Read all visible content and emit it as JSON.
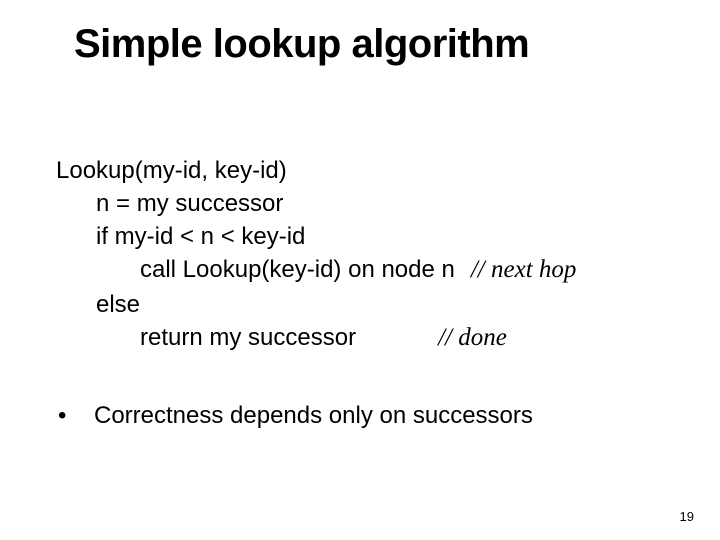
{
  "title": "Simple lookup algorithm",
  "code": {
    "l1": "Lookup(my-id, key-id)",
    "l2": "n = my successor",
    "l3": "if my-id < n < key-id",
    "l4": "call Lookup(key-id) on node n",
    "c4": "// next hop",
    "l5": "else",
    "l6": "return my successor",
    "c6": "// done"
  },
  "bullet": "Correctness depends only on successors",
  "page": "19"
}
